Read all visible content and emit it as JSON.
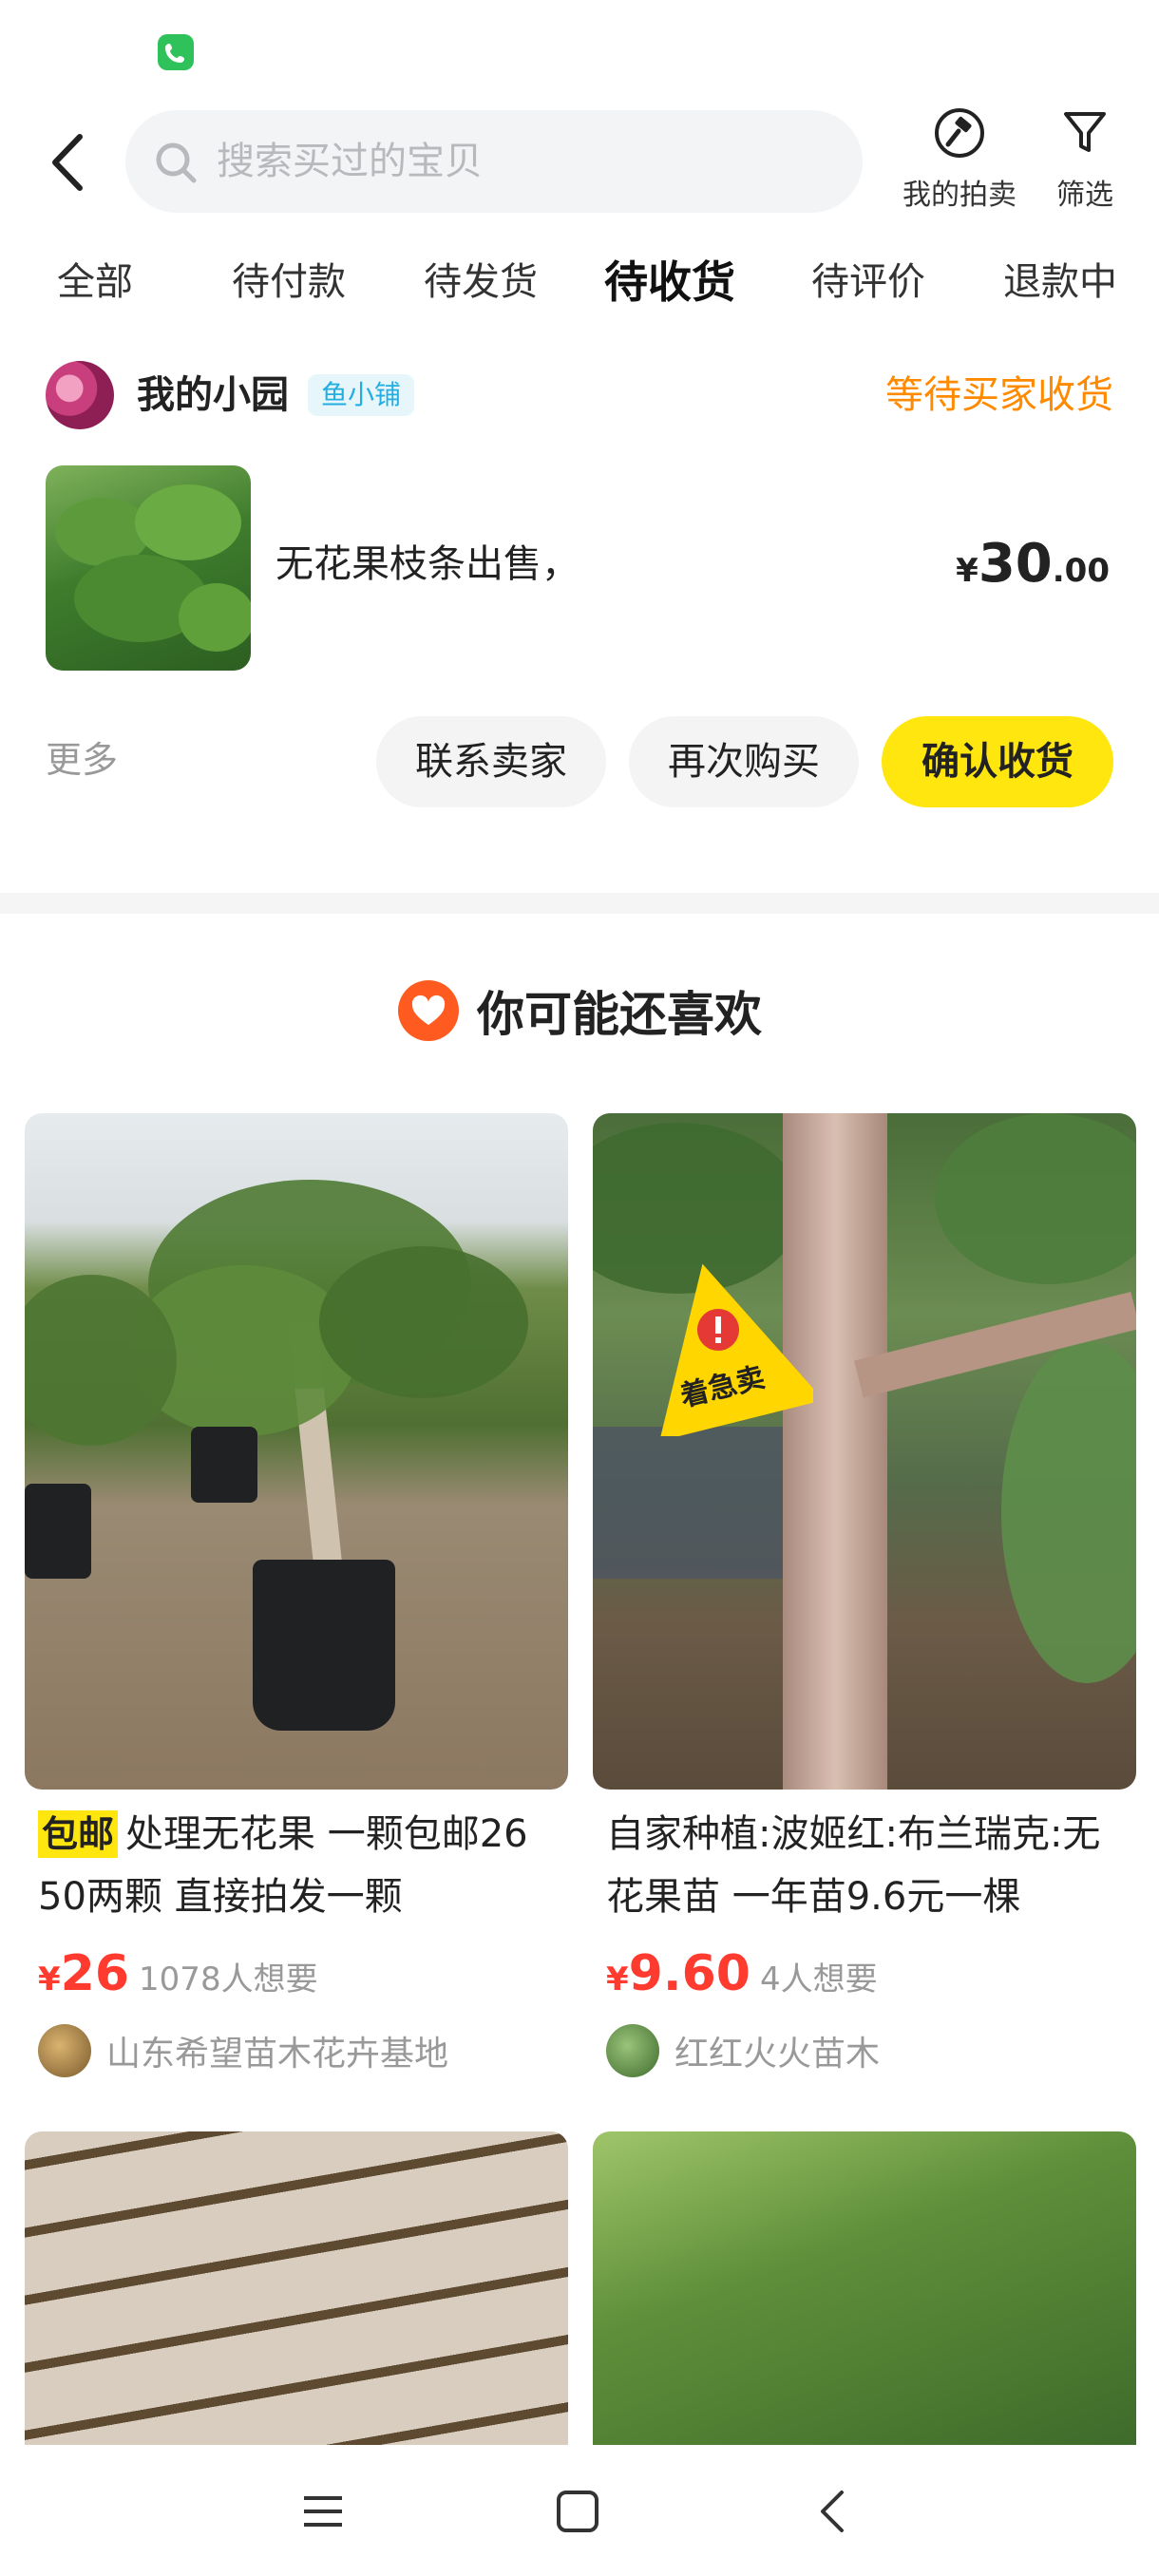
{
  "header": {
    "search_placeholder": "搜索买过的宝贝",
    "auction_label": "我的拍卖",
    "filter_label": "筛选"
  },
  "tabs": [
    {
      "label": "全部",
      "active": false
    },
    {
      "label": "待付款",
      "active": false
    },
    {
      "label": "待发货",
      "active": false
    },
    {
      "label": "待收货",
      "active": true
    },
    {
      "label": "待评价",
      "active": false
    },
    {
      "label": "退款中",
      "active": false
    }
  ],
  "order": {
    "shop_name": "我的小园",
    "shop_badge": "鱼小铺",
    "status": "等待买家收货",
    "product_title": "无花果枝条出售，",
    "price_currency": "¥",
    "price_int": "30",
    "price_dec": ".00",
    "more_label": "更多",
    "buttons": {
      "contact": "联系卖家",
      "rebuy": "再次购买",
      "confirm": "确认收货"
    }
  },
  "recommend": {
    "title": "你可能还喜欢",
    "items": [
      {
        "tag": "包邮",
        "title": "处理无花果  一颗包邮26 50两颗 直接拍发一颗",
        "currency": "¥",
        "price": "26",
        "wants": "1078人想要",
        "seller": "山东希望苗木花卉基地"
      },
      {
        "badge": "着急卖",
        "title": "自家种植:波姬红:布兰瑞克:无花果苗  一年苗9.6元一棵",
        "currency": "¥",
        "price": "9.60",
        "wants": "4人想要",
        "seller": "红红火火苗木"
      }
    ]
  },
  "colors": {
    "accent_yellow": "#ffe60f",
    "status_orange": "#ff8a00",
    "price_red": "#ff3b30",
    "badge_blue": "#22aee0"
  }
}
